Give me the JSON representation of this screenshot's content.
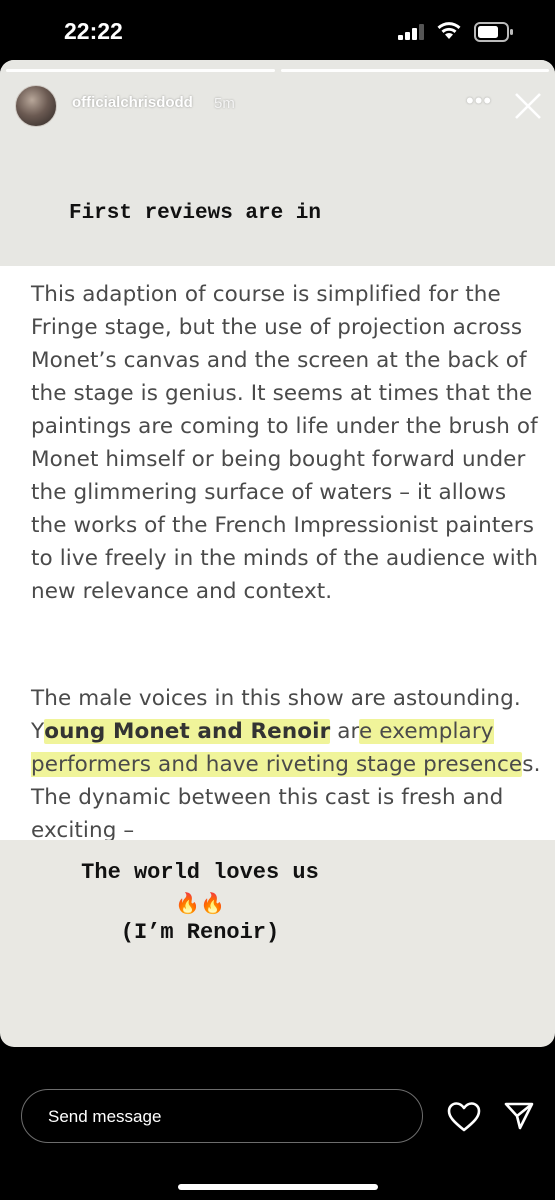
{
  "status_bar": {
    "time": "22:22",
    "signal_icon": "cellular-signal-icon",
    "wifi_icon": "wifi-icon",
    "battery_icon": "battery-icon"
  },
  "story": {
    "progress_segments": 2,
    "user": {
      "username": "officialchrisdodd",
      "time_ago": "5m",
      "avatar_icon": "avatar"
    },
    "more_icon": "more-options-icon",
    "close_icon": "close-icon",
    "caption_top": "First reviews are in",
    "review": {
      "paragraph1": "This adaption of course is simplified for the Fringe stage, but the use of projection across Monet’s canvas and the screen at the back of the stage is genius. It seems at times that the paintings are coming to life under the brush of Monet himself or being bought forward under the glimmering surface of waters – it allows the works of the French Impressionist painters to live freely in the minds of the audience with new relevance and context.",
      "paragraph2_part1": "The male voices in this show are astounding. Y",
      "paragraph2_highlight1": "oung Monet and Renoir",
      "paragraph2_part2": " ar",
      "paragraph2_highlight2": "e exemplary performers and have riveting stage presence",
      "paragraph2_part3": "s. The dynamic between this cast is fresh and exciting –"
    },
    "caption_bottom_line1": "The world loves us",
    "caption_bottom_emoji": "🔥🔥",
    "caption_bottom_line2": "(I’m Renoir)"
  },
  "footer": {
    "message_placeholder": "Send message",
    "heart_icon": "heart-icon",
    "send_icon": "send-icon"
  }
}
